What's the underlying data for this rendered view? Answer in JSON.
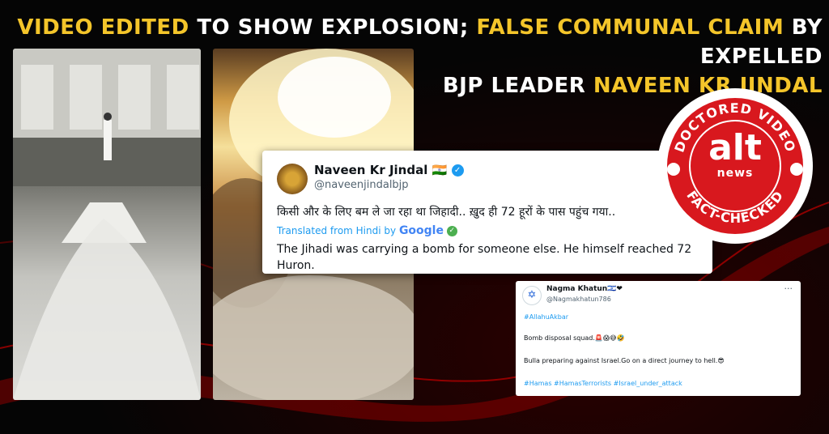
{
  "headline": {
    "part1": "Video edited",
    "part2": " to show explosion; ",
    "part3": "false communal claim",
    "part4": " by expelled",
    "part5": "BJP leader ",
    "part6": "Naveen Kr Jindal"
  },
  "tweet_main": {
    "name": "Naveen Kr Jindal",
    "flag": "🇮🇳",
    "handle": "@naveenjindalbjp",
    "original_text": "किसी और के लिए बम ले जा रहा था जिहादी.. ख़ुद ही 72 हूरों के पास पहुंच गया..",
    "translated_label": "Translated from Hindi by",
    "translator": "Google",
    "translation": "The Jihadi was carrying a bomb for someone else. He himself reached 72 Huron."
  },
  "badge": {
    "top_text": "DOCTORED VIDEO",
    "logo_main": "alt",
    "logo_sub": "news",
    "bottom_text": "FACT-CHECKED"
  },
  "tweet_second": {
    "name": "Nagma Khatun",
    "name_emoji": "🇮🇱❤",
    "handle": "@Nagmakhatun786",
    "more": "···",
    "hashtag1": "#AllahuAkbar",
    "line2": "Bomb disposal squad.🚨😱😅🤣",
    "line3": "Bulla preparing against Israel.Go on a direct journey to hell.😎",
    "hashtags": "#Hamas #HamasTerrorists #Israel_under_attack"
  },
  "colors": {
    "accent_yellow": "#f4c52a",
    "badge_red": "#d8181e",
    "twitter_blue": "#1d9bf0"
  }
}
